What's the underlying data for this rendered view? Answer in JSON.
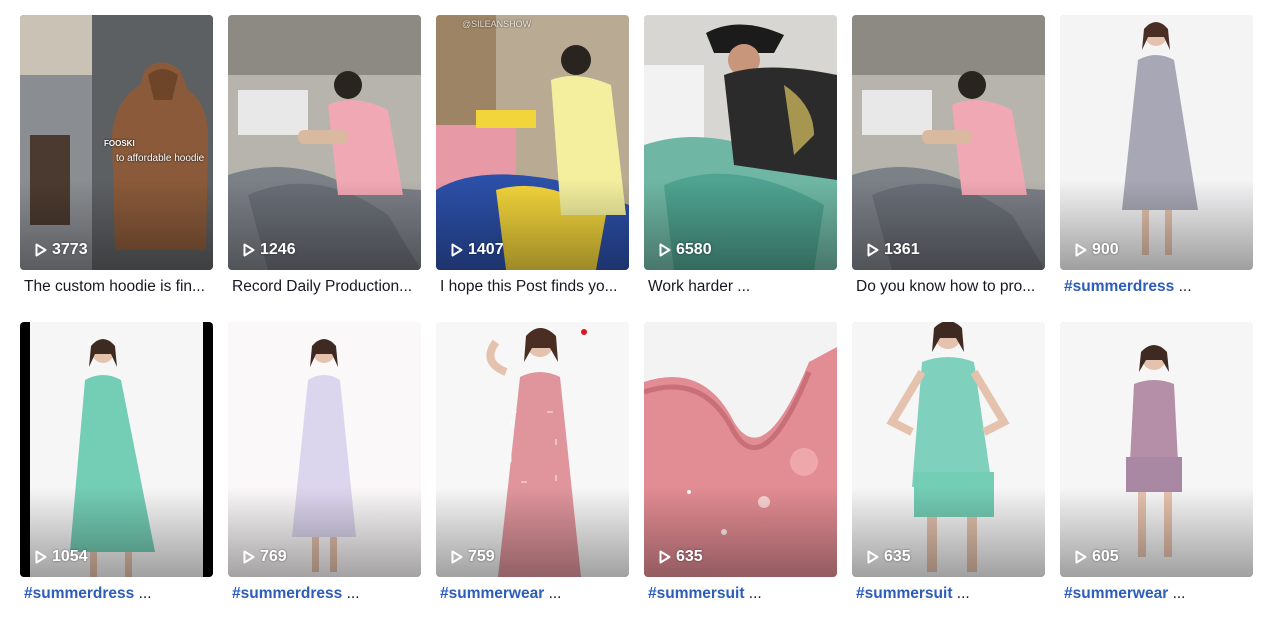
{
  "videos": [
    {
      "views": "3773",
      "caption": "The custom hoodie is fin...",
      "caption_type": "text",
      "overlay": "to affordable hoodie",
      "brand": "FOOSKI",
      "scene": "hoodie"
    },
    {
      "views": "1246",
      "caption": "Record Daily Production...",
      "caption_type": "text",
      "scene": "sewing-gray"
    },
    {
      "views": "1407",
      "caption": "I hope this Post finds yo...",
      "caption_type": "text",
      "watermark": "@SILEANSHOW",
      "scene": "sewing-yellow"
    },
    {
      "views": "6580",
      "caption": "Work harder ...",
      "caption_type": "text",
      "scene": "sewing-teal"
    },
    {
      "views": "1361",
      "caption": "Do you know how to pro...",
      "caption_type": "text",
      "scene": "sewing-gray"
    },
    {
      "views": "900",
      "caption_tag": "#summerdress",
      "caption_rest": " ...",
      "caption_type": "tag",
      "scene": "dress-gray"
    },
    {
      "views": "1054",
      "caption_tag": "#summerdress",
      "caption_rest": " ...",
      "caption_type": "tag",
      "scene": "dress-teal-bars"
    },
    {
      "views": "769",
      "caption_tag": "#summerdress",
      "caption_rest": " ...",
      "caption_type": "tag",
      "scene": "dress-lavender"
    },
    {
      "views": "759",
      "caption_tag": "#summerwear",
      "caption_rest": " ...",
      "caption_type": "tag",
      "scene": "dress-pink"
    },
    {
      "views": "635",
      "caption_tag": "#summersuit",
      "caption_rest": " ...",
      "caption_type": "tag",
      "scene": "fabric-pink"
    },
    {
      "views": "635",
      "caption_tag": "#summersuit",
      "caption_rest": " ...",
      "caption_type": "tag",
      "scene": "suit-teal"
    },
    {
      "views": "605",
      "caption_tag": "#summerwear",
      "caption_rest": " ...",
      "caption_type": "tag",
      "scene": "suit-mauve"
    }
  ],
  "colors": {
    "hashtag": "#2b5db9",
    "caption_text": "#161823",
    "view_text": "#ffffff"
  },
  "icons": {
    "views": "play-icon"
  }
}
